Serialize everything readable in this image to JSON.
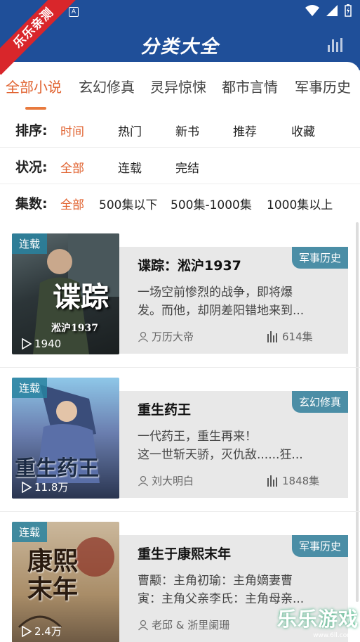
{
  "header": {
    "title": "分类大全",
    "ribbon": "乐乐亲测"
  },
  "tabs": [
    {
      "label": "全部小说",
      "active": true
    },
    {
      "label": "玄幻修真",
      "active": false
    },
    {
      "label": "灵异惊悚",
      "active": false
    },
    {
      "label": "都市言情",
      "active": false
    },
    {
      "label": "军事历史",
      "active": false
    }
  ],
  "filters": {
    "sort": {
      "label": "排序:",
      "options": [
        "时间",
        "热门",
        "新书",
        "推荐",
        "收藏"
      ],
      "selected": "时间"
    },
    "status": {
      "label": "状况:",
      "options": [
        "全部",
        "连载",
        "完结"
      ],
      "selected": "全部"
    },
    "episodes": {
      "label": "集数:",
      "options": [
        "全部",
        "500集以下",
        "500集-1000集",
        "1000集以上"
      ],
      "selected": "全部"
    }
  },
  "books": [
    {
      "status": "连载",
      "plays": "1940",
      "category": "军事历史",
      "title": "谍踪：淞沪1937",
      "desc": "一场空前惨烈的战争，即将爆\n发。而他，却阴差阳错地来到...",
      "author": "万历大帝",
      "episodes": "614集",
      "cover_text": "谍踪",
      "cover_sub": "淞沪1937"
    },
    {
      "status": "连载",
      "plays": "11.8万",
      "category": "玄幻修真",
      "title": "重生药王",
      "desc": "一代药王，重生再来！\n  这一世斩天骄，灭仇敌......狂...",
      "author": "刘大明白",
      "episodes": "1848集",
      "cover_text": "重生药王"
    },
    {
      "status": "连载",
      "plays": "2.4万",
      "category": "军事历史",
      "title": "重生于康熙末年",
      "desc": "曹颙：主角初瑜：主角嫡妻曹\n寅：主角父亲李氏：主角母亲...",
      "author": "老邱 & 浙里阑珊",
      "episodes": "",
      "cover_text": "康熙末年"
    }
  ],
  "watermark": {
    "main": "乐乐游戏",
    "sub": "www.6ll.com"
  },
  "colors": {
    "primary": "#1f4f99",
    "accent": "#e0612e",
    "ribbon": "#d9262b",
    "tag": "#4b8ea6"
  }
}
